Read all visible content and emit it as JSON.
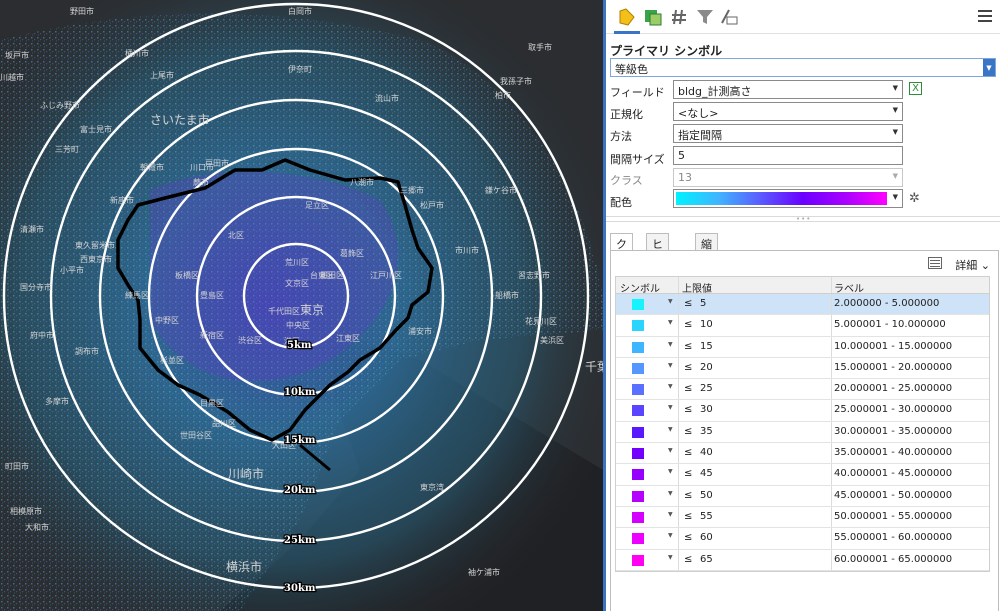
{
  "map": {
    "place_labels": [
      "野田市",
      "白岡市",
      "坂戸市",
      "桶川市",
      "上尾市",
      "伊奈町",
      "川越市",
      "ふじみ野市",
      "さいたま市",
      "流山市",
      "柏市",
      "我孫子市",
      "取手市",
      "富士見市",
      "三芳町",
      "川口市",
      "蕨市",
      "戸田市",
      "朝霞市",
      "新座市",
      "清瀬市",
      "東久留米市",
      "西東京市",
      "小平市",
      "国分寺市",
      "府中市",
      "調布市",
      "多摩市",
      "町田市",
      "大和市",
      "相模原市",
      "川崎市",
      "横浜市",
      "東京",
      "千代田区",
      "中央区",
      "港区",
      "江東区",
      "江戸川区",
      "市川市",
      "船橋市",
      "習志野市",
      "浦安市",
      "松戸市",
      "鎌ケ谷市",
      "八潮市",
      "三郷市",
      "足立区",
      "葛飾区",
      "墨田区",
      "荒川区",
      "北区",
      "板橋区",
      "練馬区",
      "中野区",
      "杉並区",
      "世田谷区",
      "目黒区",
      "品川区",
      "大田区",
      "台東区",
      "文京区",
      "豊島区",
      "新宿区",
      "渋谷区",
      "花見川区",
      "美浜区",
      "千葉",
      "東京湾",
      "袖ケ浦市"
    ],
    "ring_labels": [
      "5km",
      "10km",
      "15km",
      "20km",
      "25km",
      "30km"
    ]
  },
  "toolbar": {
    "icons": [
      "primary-symbology-icon",
      "vary-symbology-icon",
      "symbol-layers-icon",
      "filter-icon",
      "advanced-symbology-icon"
    ],
    "menu_icon": "hamburger-menu-icon"
  },
  "symbology": {
    "title": "プライマリ シンボル",
    "type_value": "等級色",
    "field_label": "フィールド",
    "field_value": "bldg_計測高さ",
    "normalize_label": "正規化",
    "normalize_value": "<なし>",
    "method_label": "方法",
    "method_value": "指定間隔",
    "interval_label": "間隔サイズ",
    "interval_value": "5",
    "classes_label": "クラス",
    "classes_value": "13",
    "ramp_label": "配色"
  },
  "tabs": [
    {
      "label": "クラス",
      "active": true
    },
    {
      "label": "ヒストグラム",
      "active": false
    },
    {
      "label": "縮尺",
      "active": false
    }
  ],
  "detail_label": "詳細",
  "table": {
    "headers": [
      "シンボル",
      "上限値",
      "ラベル"
    ],
    "rows": [
      {
        "color": "#17f2ff",
        "op": "≤",
        "upper": "5",
        "label": "2.000000 - 5.000000",
        "selected": true
      },
      {
        "color": "#2ad4ff",
        "op": "≤",
        "upper": "10",
        "label": "5.000001 - 10.000000"
      },
      {
        "color": "#3fb5ff",
        "op": "≤",
        "upper": "15",
        "label": "10.000001 - 15.000000"
      },
      {
        "color": "#5597ff",
        "op": "≤",
        "upper": "20",
        "label": "15.000001 - 20.000000"
      },
      {
        "color": "#5a70ff",
        "op": "≤",
        "upper": "25",
        "label": "20.000001 - 25.000000"
      },
      {
        "color": "#5a44ff",
        "op": "≤",
        "upper": "30",
        "label": "25.000001 - 30.000000"
      },
      {
        "color": "#5a18ff",
        "op": "≤",
        "upper": "35",
        "label": "30.000001 - 35.000000"
      },
      {
        "color": "#7300ff",
        "op": "≤",
        "upper": "40",
        "label": "35.000001 - 40.000000"
      },
      {
        "color": "#9500ff",
        "op": "≤",
        "upper": "45",
        "label": "40.000001 - 45.000000"
      },
      {
        "color": "#b600ff",
        "op": "≤",
        "upper": "50",
        "label": "45.000001 - 50.000000"
      },
      {
        "color": "#d400ff",
        "op": "≤",
        "upper": "55",
        "label": "50.000001 - 55.000000"
      },
      {
        "color": "#ec00ff",
        "op": "≤",
        "upper": "60",
        "label": "55.000001 - 60.000000"
      },
      {
        "color": "#ff00f0",
        "op": "≤",
        "upper": "65",
        "label": "60.000001 - 65.000000"
      }
    ]
  }
}
